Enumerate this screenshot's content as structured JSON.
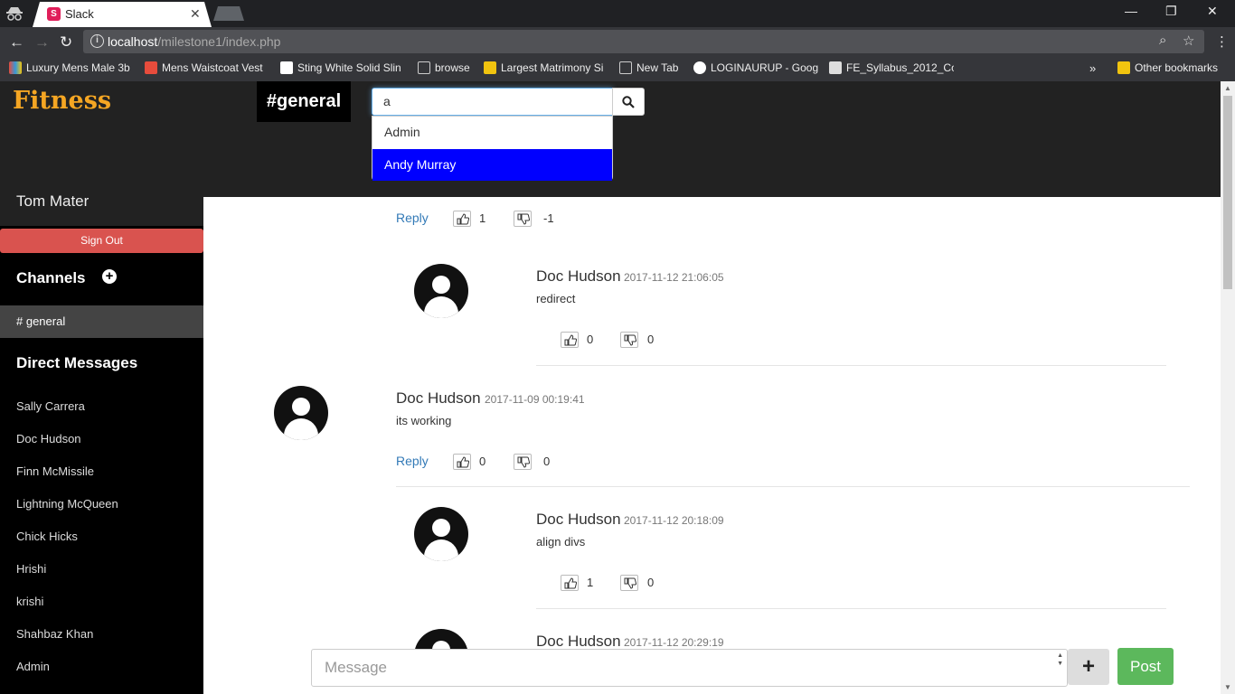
{
  "browser": {
    "tab_title": "Slack",
    "url_host": "localhost",
    "url_path": "/milestone1/index.php",
    "bookmarks": [
      {
        "label": "Luxury Mens Male 3b",
        "icon": "colorful-store-icon",
        "color": "#e8a317"
      },
      {
        "label": "Mens Waistcoat Vest",
        "icon": "shop-bag-icon",
        "color": "#e74c3c"
      },
      {
        "label": "Sting White Solid Slin",
        "icon": "amazon-icon",
        "color": "#ffffff"
      },
      {
        "label": "browse",
        "icon": "page-icon",
        "color": "#cccccc"
      },
      {
        "label": "Largest Matrimony Si",
        "icon": "matrimony-icon",
        "color": "#f1c40f"
      },
      {
        "label": "New Tab",
        "icon": "page-icon",
        "color": "#cccccc"
      },
      {
        "label": "LOGINAURUP - Goog",
        "icon": "google-icon",
        "color": "#ffffff"
      },
      {
        "label": "FE_Syllabus_2012_Co",
        "icon": "emblem-icon",
        "color": "#dddddd"
      }
    ],
    "more_label": "»",
    "other_bookmarks": "Other bookmarks"
  },
  "app": {
    "brand": "Fitness",
    "channel_badge": "#general",
    "search": {
      "value": "a",
      "suggestions": [
        "Admin",
        "Andy Murray"
      ],
      "active_suggestion": "Andy Murray"
    },
    "accent": "#f5a623"
  },
  "sidebar": {
    "user_name": "Tom Mater",
    "sign_out": "Sign Out",
    "channels_title": "Channels",
    "channels": [
      "# general"
    ],
    "dm_title": "Direct Messages",
    "direct_messages": [
      "Sally Carrera",
      "Doc Hudson",
      "Finn McMissile",
      "Lightning McQueen",
      "Chick Hicks",
      "Hrishi",
      "krishi",
      "Shahbaz Khan",
      "Admin"
    ]
  },
  "messages": {
    "top_reply": {
      "reply_label": "Reply",
      "up": "1",
      "down": "-1"
    },
    "reply1": {
      "author": "Doc Hudson",
      "time": "2017-11-12 21:06:05",
      "text": "redirect",
      "up": "0",
      "down": "0"
    },
    "main": {
      "author": "Doc Hudson",
      "time": "2017-11-09 00:19:41",
      "text": "its working",
      "reply_label": "Reply",
      "up": "0",
      "down": "0"
    },
    "reply2": {
      "author": "Doc Hudson",
      "time": "2017-11-12 20:18:09",
      "text": "align divs",
      "up": "1",
      "down": "0"
    },
    "reply3": {
      "author": "Doc Hudson",
      "time": "2017-11-12 20:29:19"
    }
  },
  "composer": {
    "placeholder": "Message",
    "attach_label": "+",
    "post_label": "Post"
  }
}
